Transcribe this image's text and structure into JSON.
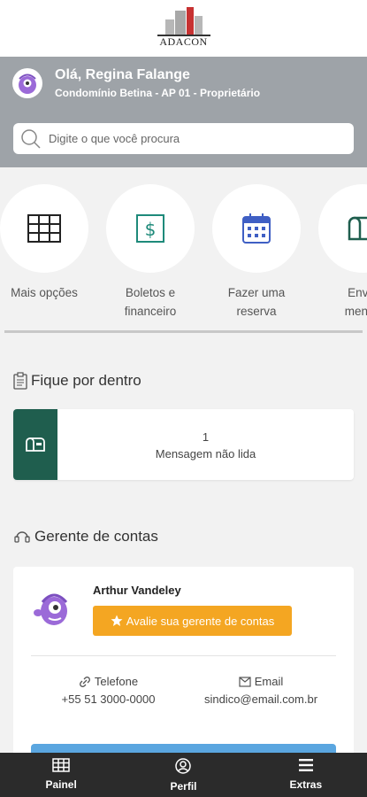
{
  "brand": {
    "logo_text": "ADACON"
  },
  "user": {
    "greeting": "Olá, Regina Falange",
    "unit": "Condomínio Betina - AP 01 - Proprietário"
  },
  "search": {
    "placeholder": "Digite o que você procura"
  },
  "actions": [
    {
      "label": "Mais opções",
      "icon": "grid-icon"
    },
    {
      "label": "Boletos e financeiro",
      "icon": "dollar-icon"
    },
    {
      "label": "Fazer uma reserva",
      "icon": "calendar-icon"
    },
    {
      "label": "Envie mensa",
      "icon": "mailbox-icon"
    }
  ],
  "news": {
    "title": "Fique por dentro",
    "unread_count": "1",
    "unread_label": "Mensagem não lida"
  },
  "manager": {
    "title": "Gerente de contas",
    "name": "Arthur Vandeley",
    "rate_label": "Avalie sua gerente de contas",
    "phone_label": "Telefone",
    "phone_value": "+55 51 3000-0000",
    "email_label": "Email",
    "email_value": "sindico@email.com.br"
  },
  "tabs": [
    {
      "label": "Painel",
      "icon": "grid-icon"
    },
    {
      "label": "Perfil",
      "icon": "user-circle-icon"
    },
    {
      "label": "Extras",
      "icon": "menu-icon"
    }
  ],
  "colors": {
    "header_gray": "#9ea3a8",
    "accent_orange": "#f4a622",
    "dark_green": "#1f5e4e",
    "tabbar": "#2b2b2b"
  }
}
